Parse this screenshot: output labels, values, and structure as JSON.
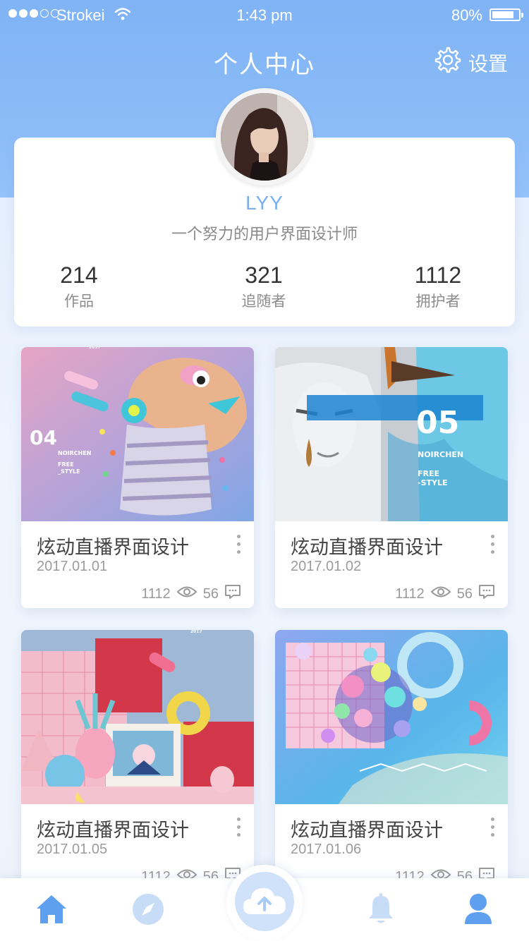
{
  "status_bar": {
    "carrier": "Strokei",
    "time": "1:43 pm",
    "battery": "80%"
  },
  "header": {
    "title": "个人中心",
    "settings_label": "设置"
  },
  "profile": {
    "username": "LYY",
    "bio": "一个努力的用户界面设计师",
    "stats": [
      {
        "value": "214",
        "label": "作品"
      },
      {
        "value": "321",
        "label": "追随者"
      },
      {
        "value": "1112",
        "label": "拥护者"
      }
    ]
  },
  "posts": [
    {
      "title": "炫动直播界面设计",
      "date": "2017.01.01",
      "views": "1112",
      "comments": "56",
      "thumb_number": "04",
      "thumb_brand": "NOIRCHEN",
      "thumb_tag1": "FREE",
      "thumb_tag2": "_STYLE",
      "thumb_year": "2017"
    },
    {
      "title": "炫动直播界面设计",
      "date": "2017.01.02",
      "views": "1112",
      "comments": "56",
      "thumb_number": "05",
      "thumb_brand": "NOIRCHEN",
      "thumb_tag1": "FREE",
      "thumb_tag2": "-STYLE"
    },
    {
      "title": "炫动直播界面设计",
      "date": "2017.01.05",
      "views": "1112",
      "comments": "56",
      "thumb_year": "2017"
    },
    {
      "title": "炫动直播界面设计",
      "date": "2017.01.06",
      "views": "1112",
      "comments": "56"
    }
  ],
  "tabbar": {
    "items": [
      "home-icon",
      "compass-icon",
      "upload-cloud-icon",
      "bell-icon",
      "user-icon"
    ],
    "active": "user-icon"
  },
  "colors": {
    "accent": "#7aaef0",
    "header": "#8dbbf7",
    "tab_active": "#5e9ff0",
    "tab_inactive": "#c7dcf7"
  }
}
